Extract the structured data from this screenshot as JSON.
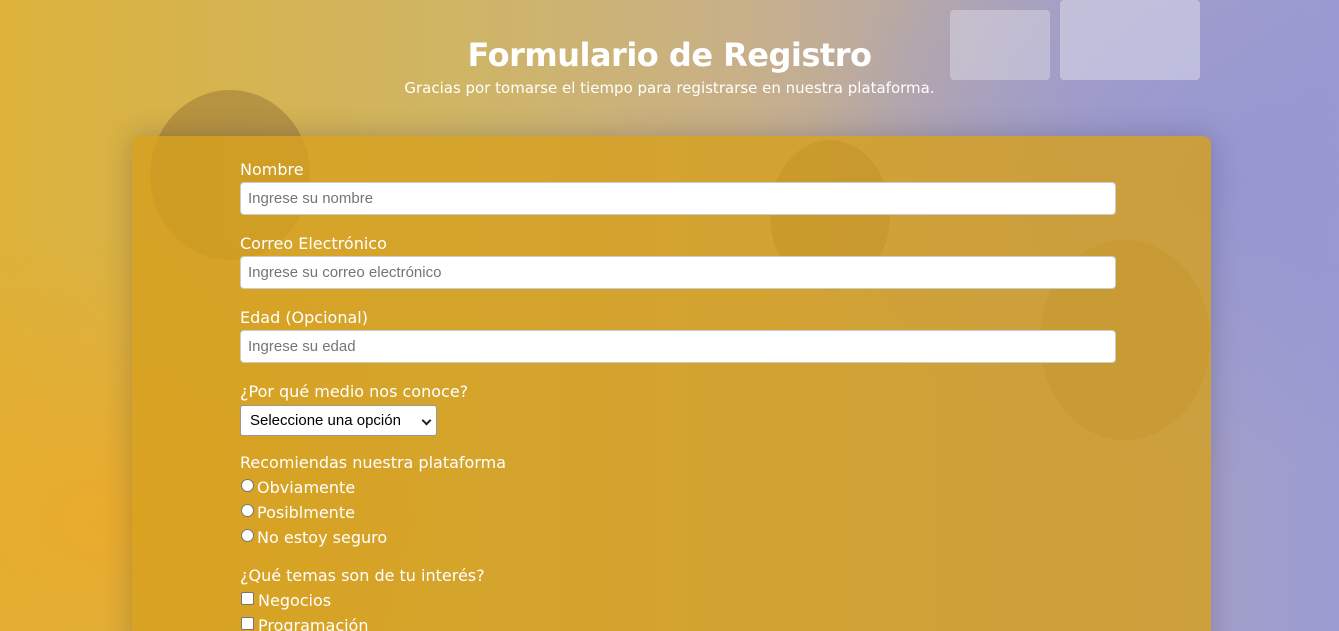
{
  "header": {
    "title": "Formulario de Registro",
    "subtitle": "Gracias por tomarse el tiempo para registrarse en nuestra plataforma."
  },
  "form": {
    "name": {
      "label": "Nombre",
      "placeholder": "Ingrese su nombre",
      "value": ""
    },
    "email": {
      "label": "Correo Electrónico",
      "placeholder": "Ingrese su correo electrónico",
      "value": ""
    },
    "age": {
      "label": "Edad (Opcional)",
      "placeholder": "Ingrese su edad",
      "value": ""
    },
    "source": {
      "label": "¿Por qué medio nos conoce?",
      "selected": "Seleccione una opción"
    },
    "recommend": {
      "label": "Recomiendas nuestra plataforma",
      "options": [
        "Obviamente",
        "Posiblmente",
        "No estoy seguro"
      ]
    },
    "interests": {
      "label": "¿Qué temas son de tu interés?",
      "options": [
        "Negocios",
        "Programación"
      ]
    }
  },
  "colors": {
    "card": "#d6a01e",
    "text": "#ffffff",
    "accent_purple": "#9c9cd2"
  }
}
